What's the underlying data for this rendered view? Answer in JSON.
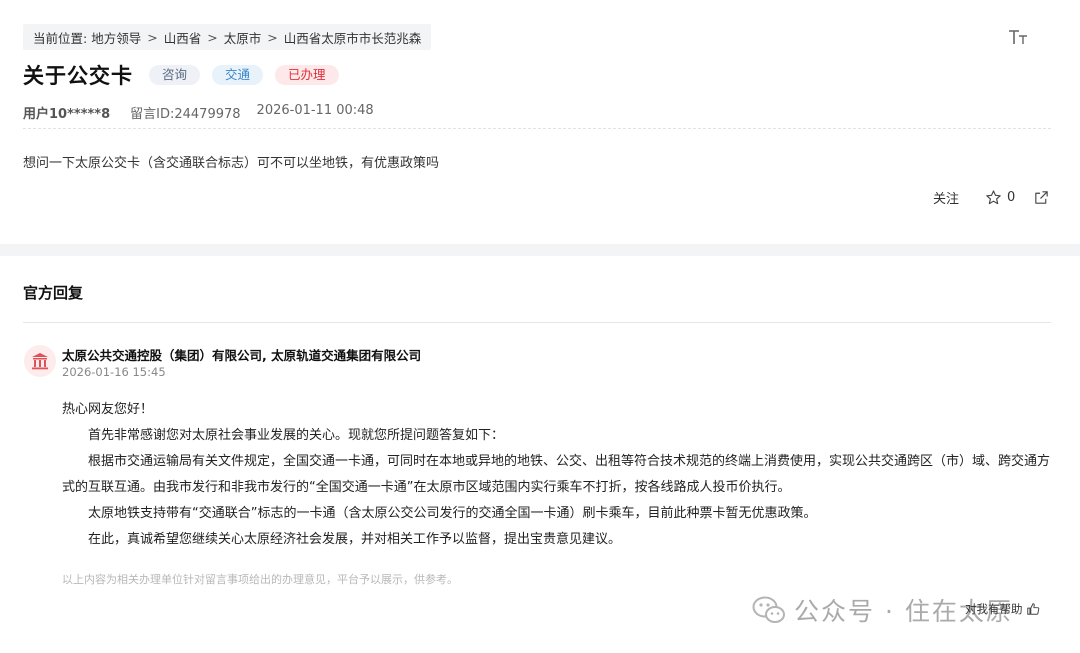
{
  "breadcrumb": {
    "prefix": "当前位置:",
    "items": [
      "地方领导",
      "山西省",
      "太原市",
      "山西省太原市市长范兆森"
    ],
    "separator": ">"
  },
  "toolbar": {
    "font_size_icon": "font-size-icon"
  },
  "message": {
    "title": "关于公交卡",
    "tags": {
      "consult": "咨询",
      "traffic": "交通",
      "status": "已办理"
    },
    "user": "用户10*****8",
    "message_id": "留言ID:24479978",
    "time": "2026-01-11 00:48",
    "content": "想问一下太原公交卡（含交通联合标志）可不可以坐地铁，有优惠政策吗"
  },
  "actions": {
    "follow_label": "关注",
    "star_count": "0",
    "star_icon": "star-icon",
    "share_icon": "share-icon"
  },
  "reply": {
    "heading": "官方回复",
    "org_icon": "government-building-icon",
    "org_name": "太原公共交通控股（集团）有限公司, 太原轨道交通集团有限公司",
    "time": "2026-01-16 15:45",
    "greeting": "热心网友您好！",
    "paragraphs": [
      "首先非常感谢您对太原社会事业发展的关心。现就您所提问题答复如下：",
      "根据市交通运输局有关文件规定，全国交通一卡通，可同时在本地或异地的地铁、公交、出租等符合技术规范的终端上消费使用，实现公共交通跨区（市）域、跨交通方式的互联互通。由我市发行和非我市发行的“全国交通一卡通”在太原市区域范围内实行乘车不打折，按各线路成人投币价执行。",
      "太原地铁支持带有“交通联合”标志的一卡通（含太原公交公司发行的交通全国一卡通）刷卡乘车，目前此种票卡暂无优惠政策。",
      "在此，真诚希望您继续关心太原经济社会发展，并对相关工作予以监督，提出宝贵意见建议。"
    ],
    "disclaimer": "以上内容为相关办理单位针对留言事项给出的办理意见，平台予以展示，供参考。",
    "helpful_label": "对我有帮助",
    "helpful_icon": "thumbs-up-icon"
  },
  "watermark": {
    "text": "公众号 · 住在太原",
    "icon": "wechat-icon"
  },
  "colors": {
    "status_red": "#e0303a",
    "tag_blue": "#3a86c8",
    "page_gap": "#f3f4f6"
  }
}
